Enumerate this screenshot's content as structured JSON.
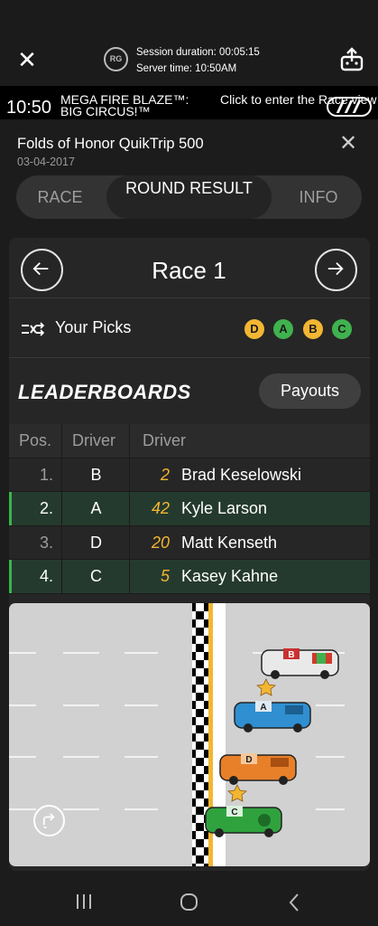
{
  "header": {
    "close_icon": "close-icon",
    "logo_text": "RG",
    "session_duration": "Session duration: 00:05:15",
    "server_time": "Server time: 10:50AM",
    "share_icon": "share-icon"
  },
  "ticker": {
    "time": "10:50",
    "title": "MEGA FIRE BLAZE™: BIG CIRCUS!™",
    "cta": "Click to enter the Race view"
  },
  "event": {
    "name": "Folds of Honor QuikTrip 500",
    "date": "03-04-2017"
  },
  "tabs": {
    "race": "RACE",
    "round_result": "ROUND RESULT",
    "info": "INFO",
    "active": "round_result"
  },
  "race": {
    "title": "Race 1",
    "picks_label": "Your Picks",
    "picks": [
      {
        "letter": "D",
        "color": "#f2b632"
      },
      {
        "letter": "A",
        "color": "#3fb24f"
      },
      {
        "letter": "B",
        "color": "#f2b632"
      },
      {
        "letter": "C",
        "color": "#3fb24f"
      }
    ]
  },
  "leaderboard": {
    "title": "LEADERBOARDS",
    "payouts_label": "Payouts",
    "columns": [
      "Pos.",
      "Driver",
      "Driver"
    ],
    "rows": [
      {
        "pos": "1.",
        "letter": "B",
        "number": "2",
        "name": "Brad Keselowski",
        "matched": false
      },
      {
        "pos": "2.",
        "letter": "A",
        "number": "42",
        "name": "Kyle Larson",
        "matched": true
      },
      {
        "pos": "3.",
        "letter": "D",
        "number": "20",
        "name": "Matt Kenseth",
        "matched": false
      },
      {
        "pos": "4.",
        "letter": "C",
        "number": "5",
        "name": "Kasey Kahne",
        "matched": true
      }
    ]
  },
  "track": {
    "cars": [
      {
        "letter": "B",
        "color": "#e9e9e9"
      },
      {
        "letter": "A",
        "color": "#2f8fd0"
      },
      {
        "letter": "D",
        "color": "#e8802a"
      },
      {
        "letter": "C",
        "color": "#2fa23e"
      }
    ],
    "replay_icon": "replay-icon"
  },
  "colors": {
    "accent_yellow": "#f2b632",
    "accent_green": "#39b54a",
    "row_green": "#253a2e"
  }
}
